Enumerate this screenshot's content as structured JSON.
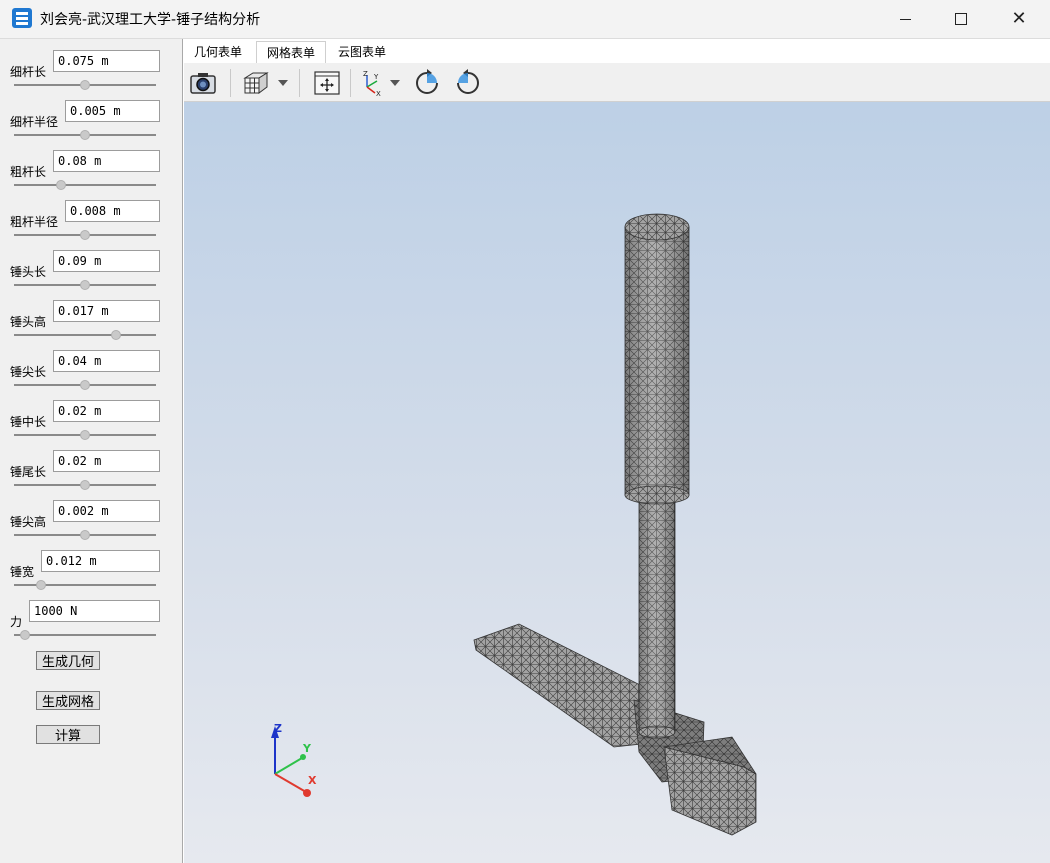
{
  "window": {
    "title": "刘会亮-武汉理工大学-锤子结构分析"
  },
  "params": [
    {
      "label": "细杆长",
      "value": "0.075 m",
      "slider": 0.5
    },
    {
      "label": "细杆半径",
      "value": "0.005 m",
      "slider": 0.5
    },
    {
      "label": "粗杆长",
      "value": "0.08 m",
      "slider": 0.33
    },
    {
      "label": "粗杆半径",
      "value": "0.008 m",
      "slider": 0.5
    },
    {
      "label": "锤头长",
      "value": "0.09 m",
      "slider": 0.5
    },
    {
      "label": "锤头高",
      "value": "0.017 m",
      "slider": 0.72
    },
    {
      "label": "锤尖长",
      "value": "0.04 m",
      "slider": 0.5
    },
    {
      "label": "锤中长",
      "value": "0.02 m",
      "slider": 0.5
    },
    {
      "label": "锤尾长",
      "value": "0.02 m",
      "slider": 0.5
    },
    {
      "label": "锤尖高",
      "value": "0.002 m",
      "slider": 0.5
    },
    {
      "label": "锤宽",
      "value": "0.012 m",
      "slider": 0.19
    },
    {
      "label": "力",
      "value": "1000 N",
      "slider": 0.08
    }
  ],
  "buttons": {
    "gen_geometry": "生成几何",
    "gen_mesh": "生成网格",
    "compute": "计算"
  },
  "tabs": [
    "几何表单",
    "网格表单",
    "云图表单"
  ],
  "active_tab": "网格表单",
  "toolbar": [
    "camera-icon",
    "view-cube-icon",
    "fit-view-icon",
    "axes-icon",
    "rotate-cw-icon",
    "rotate-ccw-icon"
  ],
  "axes": {
    "z": "Z",
    "y": "Y",
    "x": "X"
  },
  "colors": {
    "viewport_top": "#bdd0e6",
    "viewport_bottom": "#e6e9ef",
    "mesh": "#9a9a9a"
  }
}
